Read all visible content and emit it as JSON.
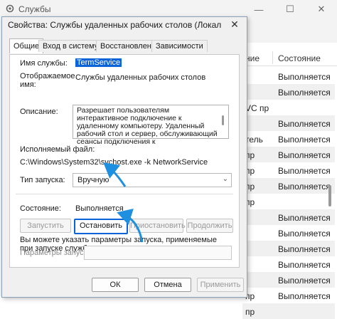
{
  "background_window": {
    "title": "Службы",
    "columns": [
      "Состояние"
    ],
    "col_partial": "ние",
    "rows": [
      {
        "c1": "",
        "c2": "Выполняется"
      },
      {
        "c1": "",
        "c2": "Выполняется"
      },
      {
        "c1": "VC пр",
        "c2": ""
      },
      {
        "c1": "",
        "c2": "Выполняется"
      },
      {
        "c1": "тель",
        "c2": "Выполняется"
      },
      {
        "c1": "пр",
        "c2": "Выполняется"
      },
      {
        "c1": "пр",
        "c2": "Выполняется"
      },
      {
        "c1": "пр",
        "c2": "Выполняется"
      },
      {
        "c1": "пр",
        "c2": ""
      },
      {
        "c1": "",
        "c2": "Выполняется"
      },
      {
        "c1": "",
        "c2": "Выполняется"
      },
      {
        "c1": "",
        "c2": "Выполняется"
      },
      {
        "c1": "",
        "c2": "Выполняется"
      },
      {
        "c1": "",
        "c2": "Выполняется"
      },
      {
        "c1": "пр",
        "c2": "Выполняется"
      },
      {
        "c1": "пр",
        "c2": ""
      }
    ],
    "minimize": "—",
    "maximize": "☐",
    "close": "✕",
    "accent": "#0a64d8"
  },
  "dialog": {
    "title": "Свойства: Службы удаленных рабочих столов (Локальный ком...",
    "close_icon": "✕",
    "tabs": [
      "Общие",
      "Вход в систему",
      "Восстановление",
      "Зависимости"
    ],
    "service_name_label": "Имя службы:",
    "service_name_value": "TermService",
    "display_name_label": "Отображаемое имя:",
    "display_name_value": "Службы удаленных рабочих столов",
    "description_label": "Описание:",
    "description_value": "Разрешает пользователям интерактивное подключение к удаленному компьютеру. Удаленный рабочий стол и сервер, обслуживающий сеансы подключения к",
    "exe_label": "Исполняемый файл:",
    "exe_value": "C:\\Windows\\System32\\svchost.exe -k NetworkService",
    "startup_type_label": "Тип запуска:",
    "startup_type_value": "Вручную",
    "status_label": "Состояние:",
    "status_value": "Выполняется",
    "start_button": "Запустить",
    "stop_button": "Остановить",
    "pause_button": "Приостановить",
    "resume_button": "Продолжить",
    "hint_text": "Вы можете указать параметры запуска, применяемые при запуске службы из этого диалогового окна.",
    "params_label": "Параметры запуска:",
    "params_value": "",
    "ok_button": "ОК",
    "cancel_button": "Отмена",
    "apply_button": "Применить"
  }
}
